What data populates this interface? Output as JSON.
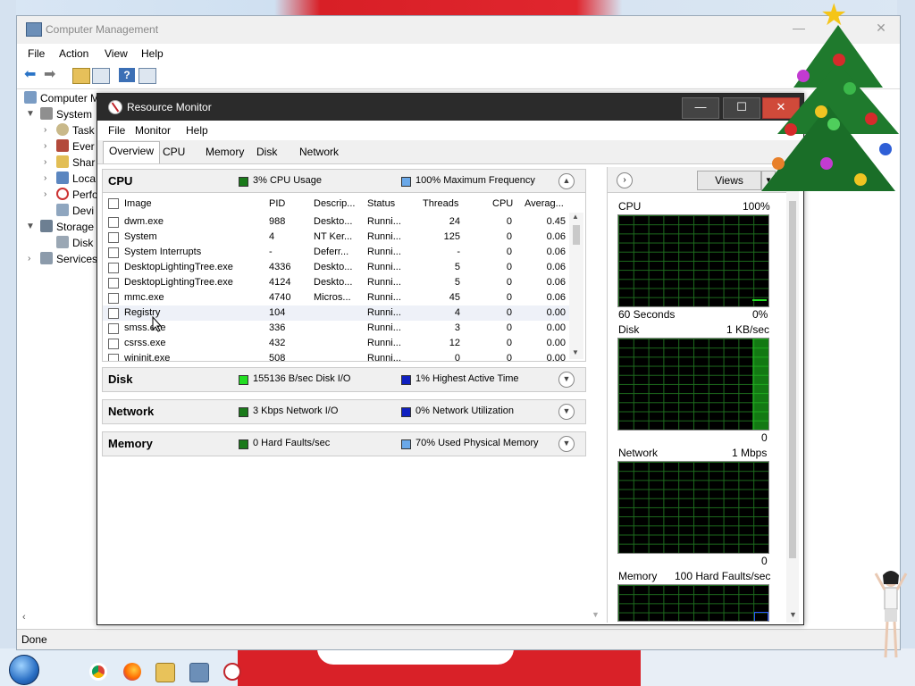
{
  "computer_management": {
    "title": "Computer Management",
    "menu": [
      "File",
      "Action",
      "View",
      "Help"
    ],
    "tree": [
      {
        "label": "Computer M",
        "level": 0
      },
      {
        "label": "System",
        "level": 1
      },
      {
        "label": "Task",
        "level": 2
      },
      {
        "label": "Ever",
        "level": 2
      },
      {
        "label": "Shar",
        "level": 2
      },
      {
        "label": "Loca",
        "level": 2
      },
      {
        "label": "Perfo",
        "level": 2
      },
      {
        "label": "Devi",
        "level": 2
      },
      {
        "label": "Storage",
        "level": 1
      },
      {
        "label": "Disk",
        "level": 2
      },
      {
        "label": "Services",
        "level": 1
      }
    ],
    "status": "Done"
  },
  "resource_monitor": {
    "title": "Resource Monitor",
    "menu": [
      "File",
      "Monitor",
      "Help"
    ],
    "tabs": [
      "Overview",
      "CPU",
      "Memory",
      "Disk",
      "Network"
    ],
    "active_tab": "Overview",
    "cpu": {
      "title": "CPU",
      "usage": "3% CPU Usage",
      "frequency": "100% Maximum Frequency",
      "usage_color": "#1a7a1a",
      "frequency_color": "#6aa8e8",
      "columns": [
        "Image",
        "PID",
        "Descrip...",
        "Status",
        "Threads",
        "CPU",
        "Averag..."
      ],
      "rows": [
        {
          "image": "dwm.exe",
          "pid": "988",
          "desc": "Deskto...",
          "status": "Runni...",
          "threads": "24",
          "cpu": "0",
          "avg": "0.45"
        },
        {
          "image": "System",
          "pid": "4",
          "desc": "NT Ker...",
          "status": "Runni...",
          "threads": "125",
          "cpu": "0",
          "avg": "0.06"
        },
        {
          "image": "System Interrupts",
          "pid": "-",
          "desc": "Deferr...",
          "status": "Runni...",
          "threads": "-",
          "cpu": "0",
          "avg": "0.06"
        },
        {
          "image": "DesktopLightingTree.exe",
          "pid": "4336",
          "desc": "Deskto...",
          "status": "Runni...",
          "threads": "5",
          "cpu": "0",
          "avg": "0.06"
        },
        {
          "image": "DesktopLightingTree.exe",
          "pid": "4124",
          "desc": "Deskto...",
          "status": "Runni...",
          "threads": "5",
          "cpu": "0",
          "avg": "0.06"
        },
        {
          "image": "mmc.exe",
          "pid": "4740",
          "desc": "Micros...",
          "status": "Runni...",
          "threads": "45",
          "cpu": "0",
          "avg": "0.06"
        },
        {
          "image": "Registry",
          "pid": "104",
          "desc": "",
          "status": "Runni...",
          "threads": "4",
          "cpu": "0",
          "avg": "0.00"
        },
        {
          "image": "smss.exe",
          "pid": "336",
          "desc": "",
          "status": "Runni...",
          "threads": "3",
          "cpu": "0",
          "avg": "0.00"
        },
        {
          "image": "csrss.exe",
          "pid": "432",
          "desc": "",
          "status": "Runni...",
          "threads": "12",
          "cpu": "0",
          "avg": "0.00"
        },
        {
          "image": "wininit.exe",
          "pid": "508",
          "desc": "",
          "status": "Runni...",
          "threads": "0",
          "cpu": "0",
          "avg": "0.00"
        }
      ]
    },
    "disk": {
      "title": "Disk",
      "io": "155136 B/sec Disk I/O",
      "active": "1% Highest Active Time",
      "io_color": "#22dd22",
      "active_color": "#1020c0"
    },
    "network": {
      "title": "Network",
      "io": "3 Kbps Network I/O",
      "util": "0% Network Utilization",
      "io_color": "#1a7a1a",
      "util_color": "#1020c0"
    },
    "memory": {
      "title": "Memory",
      "faults": "0 Hard Faults/sec",
      "used": "70% Used Physical Memory",
      "faults_color": "#1a7a1a",
      "used_color": "#6aa8e8"
    },
    "graphs": {
      "views_label": "Views",
      "cpu": {
        "label": "CPU",
        "max": "100%",
        "time": "60 Seconds",
        "min": "0%"
      },
      "disk": {
        "label": "Disk",
        "max": "1 KB/sec",
        "min": "0"
      },
      "network": {
        "label": "Network",
        "max": "1 Mbps",
        "min": "0"
      },
      "memory": {
        "label": "Memory",
        "max": "100 Hard Faults/sec"
      }
    }
  }
}
